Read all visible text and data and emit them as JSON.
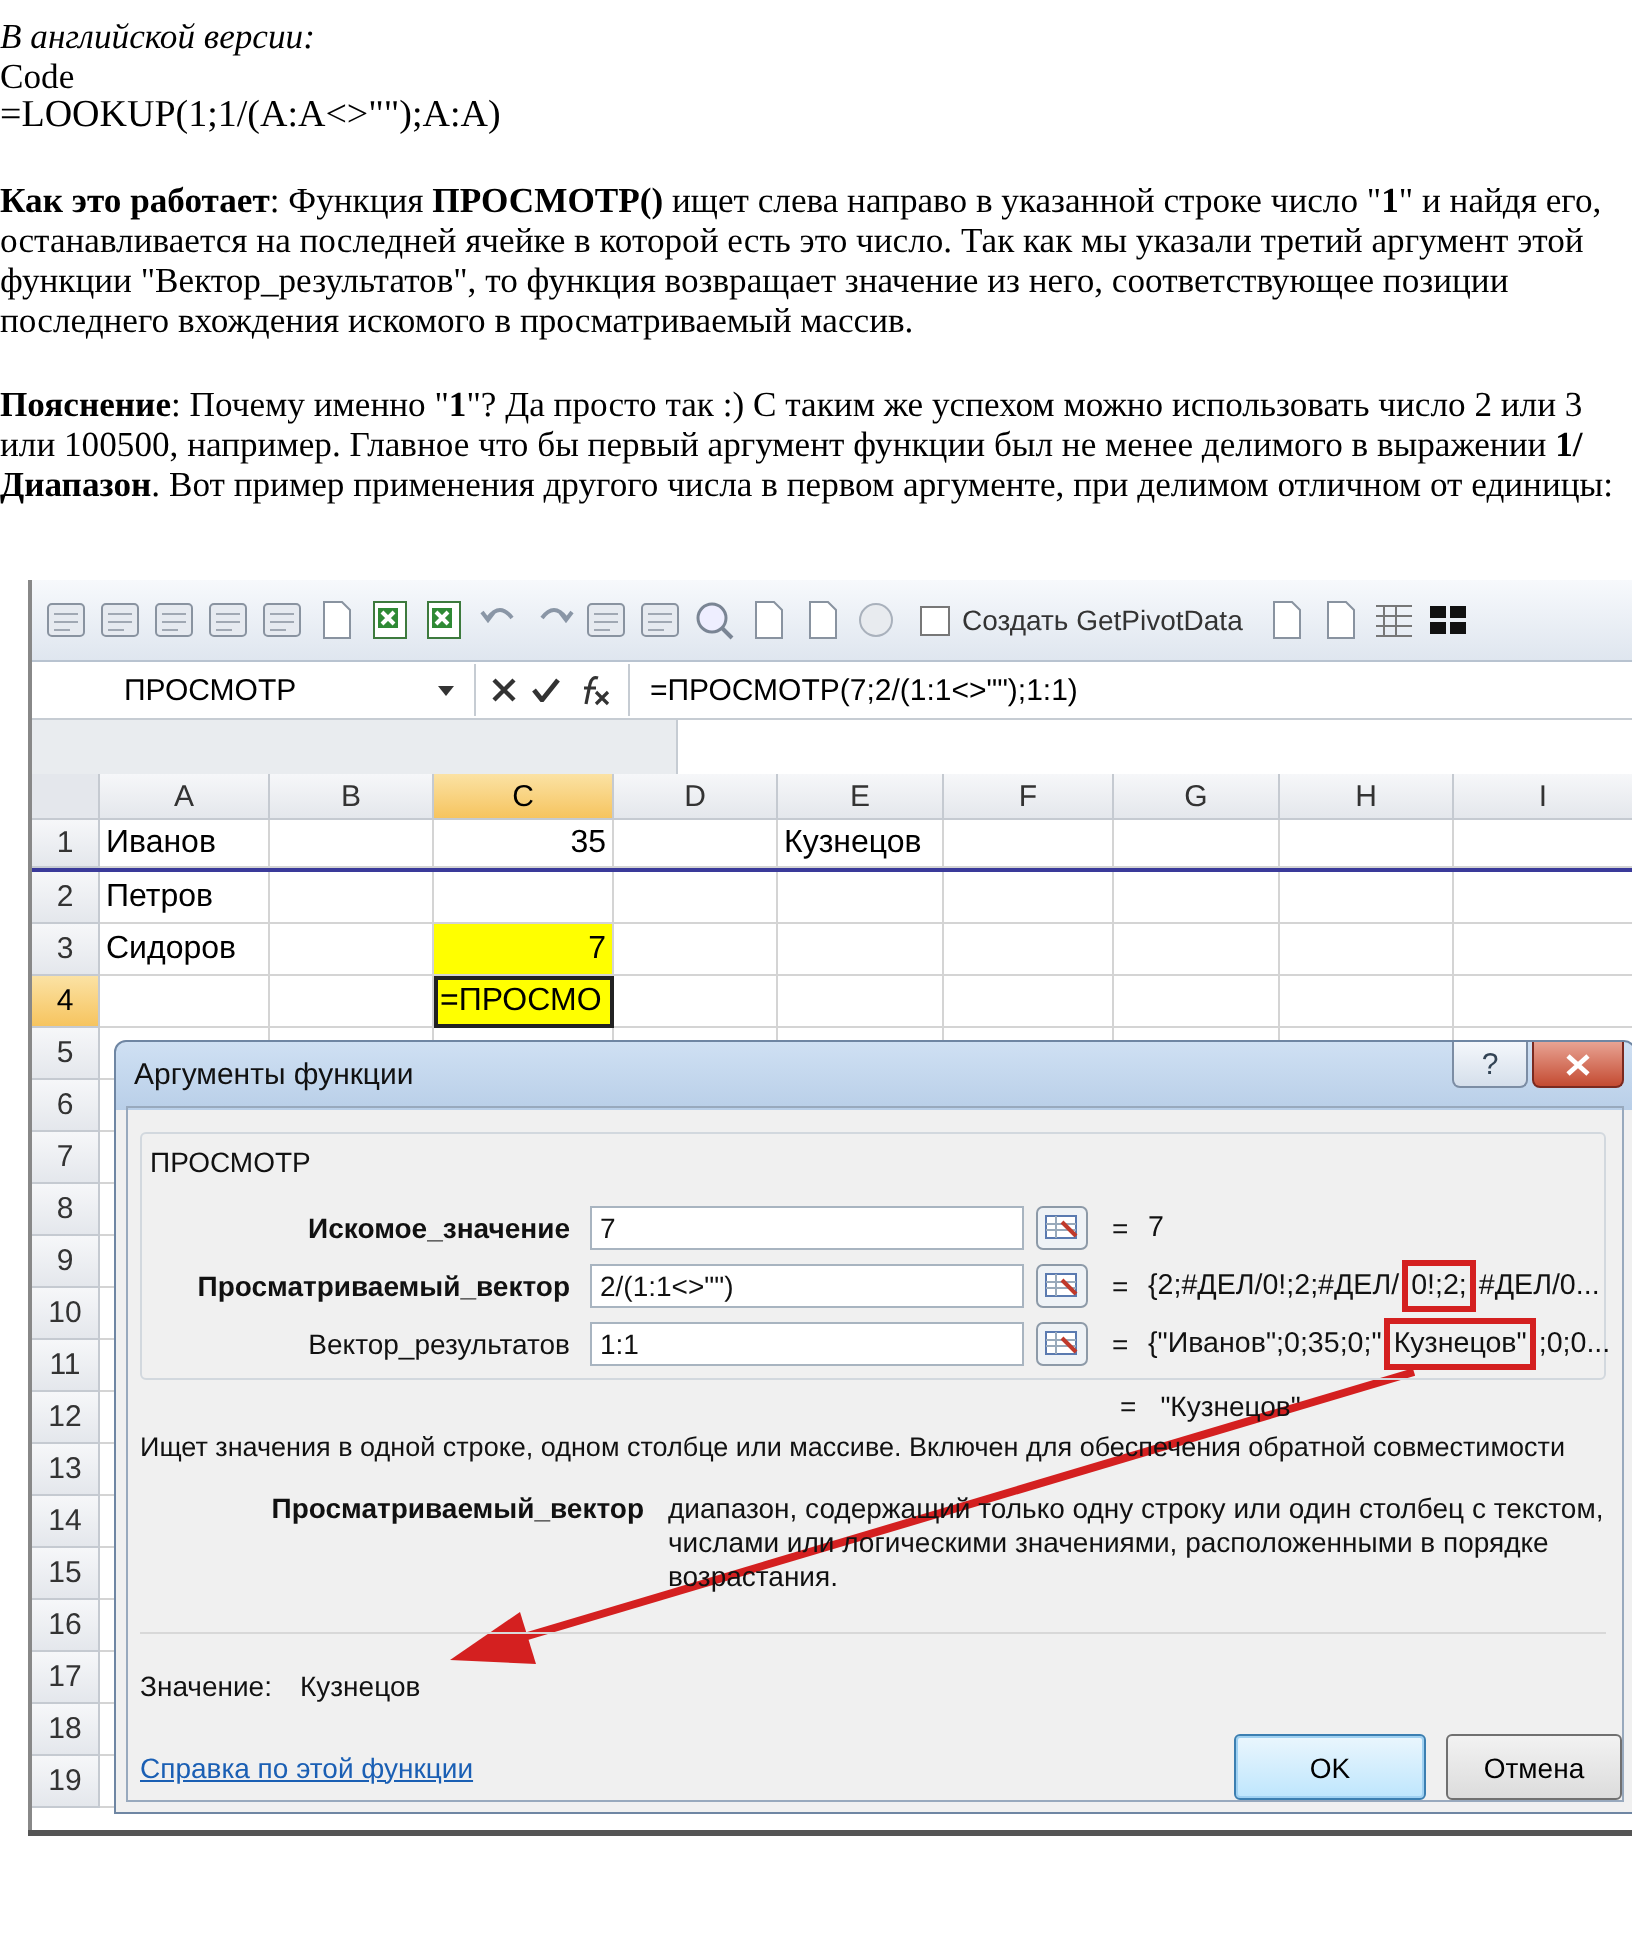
{
  "document": {
    "heading": "В английской версии:",
    "code_label": "Code",
    "formula": "=LOOKUP(1;1/(A:A<>\"\");A:A)",
    "paragraphs": [
      "**Как это работает**: Функция **ПРОСМОТР()** ищет слева направо в указанной строке число \"**1**\" и найдя его, останавливается на последней ячейке в которой есть это число. Так как мы указали третий аргумент этой функции \"Вектор_результатов\", то функция возвращает значение из него, соответствующее позиции последнего вхождения искомого в просматриваемый массив.",
      "**Пояснение**: Почему именно \"**1**\"? Да просто так :) С таким же успехом можно использовать число 2 или 3 или 100500, например. Главное что бы первый аргумент функции был не менее делимого в выражении **1/Диапазон**. Вот пример применения другого числа в первом аргументе, при делимом отличном от единицы:"
    ]
  },
  "screenshot": {
    "toolbar": {
      "pivot_checkbox": {
        "label": "Создать GetPivotData",
        "checked": false
      }
    },
    "formula_bar": {
      "name_box": "ПРОСМОТР",
      "formula": "=ПРОСМОТР(7;2/(1:1<>\"\");1:1)"
    },
    "sheet": {
      "columns": [
        {
          "label": "A",
          "selected": false
        },
        {
          "label": "B",
          "selected": false
        },
        {
          "label": "C",
          "selected": true
        },
        {
          "label": "D",
          "selected": false
        },
        {
          "label": "E",
          "selected": false
        },
        {
          "label": "F",
          "selected": false
        },
        {
          "label": "G",
          "selected": false
        },
        {
          "label": "H",
          "selected": false
        },
        {
          "label": "I",
          "selected": false
        }
      ],
      "rows": [
        {
          "label": "1",
          "selected": false,
          "referenced": true,
          "cells": [
            {
              "text": "Иванов",
              "kind": "text",
              "highlighted": false
            },
            {},
            {
              "text": "35",
              "kind": "number",
              "highlighted": false
            },
            {},
            {
              "text": "Кузнецов",
              "kind": "text",
              "highlighted": false
            }
          ]
        },
        {
          "label": "2",
          "selected": false,
          "referenced": false,
          "cells": [
            {
              "text": "Петров",
              "kind": "text",
              "highlighted": false
            }
          ]
        },
        {
          "label": "3",
          "selected": false,
          "referenced": false,
          "cells": [
            {
              "text": "Сидоров",
              "kind": "text",
              "highlighted": false
            },
            {},
            {
              "text": "7",
              "kind": "number",
              "highlighted": true
            }
          ]
        },
        {
          "label": "4",
          "selected": true,
          "referenced": false,
          "cells": [
            {},
            {},
            {
              "text": "=ПРОСМО",
              "kind": "editing",
              "highlighted": true
            }
          ]
        },
        {
          "label": "5",
          "selected": false,
          "referenced": false,
          "cells": []
        },
        {
          "label": "6",
          "selected": false,
          "referenced": false,
          "cells": []
        },
        {
          "label": "7",
          "selected": false,
          "referenced": false,
          "cells": []
        },
        {
          "label": "8",
          "selected": false,
          "referenced": false,
          "cells": []
        },
        {
          "label": "9",
          "selected": false,
          "referenced": false,
          "cells": []
        },
        {
          "label": "10",
          "selected": false,
          "referenced": false,
          "cells": []
        },
        {
          "label": "11",
          "selected": false,
          "referenced": false,
          "cells": []
        },
        {
          "label": "12",
          "selected": false,
          "referenced": false,
          "cells": []
        },
        {
          "label": "13",
          "selected": false,
          "referenced": false,
          "cells": []
        },
        {
          "label": "14",
          "selected": false,
          "referenced": false,
          "cells": []
        },
        {
          "label": "15",
          "selected": false,
          "referenced": false,
          "cells": []
        },
        {
          "label": "16",
          "selected": false,
          "referenced": false,
          "cells": []
        },
        {
          "label": "17",
          "selected": false,
          "referenced": false,
          "cells": []
        },
        {
          "label": "18",
          "selected": false,
          "referenced": false,
          "cells": []
        },
        {
          "label": "19",
          "selected": false,
          "referenced": false,
          "cells": []
        }
      ]
    },
    "dialog": {
      "title": "Аргументы функции",
      "help_button": "?",
      "function_name": "ПРОСМОТР",
      "arguments": [
        {
          "label": "Искомое_значение",
          "required": true,
          "value": "7",
          "sign": "=",
          "result": [
            {
              "text": "7",
              "highlighted": false
            }
          ]
        },
        {
          "label": "Просматриваемый_вектор",
          "required": true,
          "value": "2/(1:1<>\"\")",
          "sign": "=",
          "result": [
            {
              "text": "{2;#ДЕЛ/0!;2;#ДЕЛ/",
              "highlighted": false
            },
            {
              "text": "0!;2;",
              "highlighted": true
            },
            {
              "text": "#ДЕЛ/0...",
              "highlighted": false
            }
          ]
        },
        {
          "label": "Вектор_результатов",
          "required": false,
          "value": "1:1",
          "sign": "=",
          "result": [
            {
              "text": "{\"Иванов\";0;35;0;\"",
              "highlighted": false
            },
            {
              "text": "Кузнецов\"",
              "highlighted": true
            },
            {
              "text": ";0;0...",
              "highlighted": false
            }
          ]
        }
      ],
      "formula_result": {
        "sign": "=",
        "value": "\"Кузнецов\""
      },
      "description": "Ищет значения в одной строке, одном столбце или массиве. Включен для обеспечения обратной совместимости",
      "argument_help": {
        "name": "Просматриваемый_вектор",
        "text": "диапазон, содержащий только одну строку или один столбец с текстом, числами или логическими значениями, расположенными в порядке возрастания."
      },
      "value_label": "Значение:",
      "value": "Кузнецов",
      "help_link": "Справка по этой функции",
      "buttons": [
        {
          "label": "OK",
          "kind": "default"
        },
        {
          "label": "Отмена",
          "kind": "normal"
        }
      ]
    }
  }
}
